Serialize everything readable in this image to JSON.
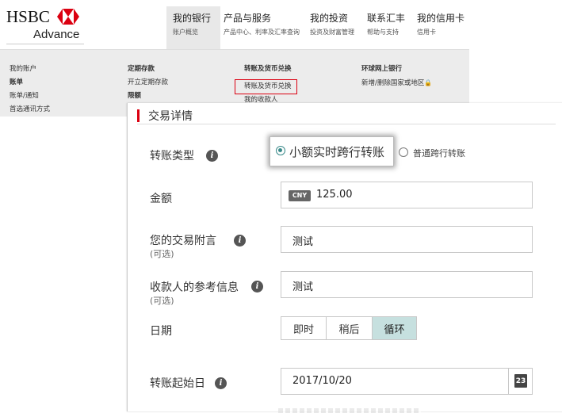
{
  "logo": {
    "brand": "HSBC",
    "sub": "Advance"
  },
  "nav": [
    {
      "title": "我的银行",
      "sub": "账户概览",
      "active": true
    },
    {
      "title": "产品与服务",
      "sub": "产品中心、利率及汇率查询"
    },
    {
      "title": "我的投资",
      "sub": "投资及财富管理"
    },
    {
      "title": "联系汇丰",
      "sub": "帮助与支持"
    },
    {
      "title": "我的信用卡",
      "sub": "信用卡"
    }
  ],
  "menu": {
    "col1": [
      "我的账户",
      "账单",
      "账单/通知",
      "首选通讯方式"
    ],
    "col2": [
      "定期存款",
      "开立定期存款",
      "限额"
    ],
    "col3": [
      "转账及货币兑换",
      "转账及货币兑换",
      "我的收款人"
    ],
    "col4": [
      "环球网上银行",
      "新增/删除国家或地区"
    ]
  },
  "form": {
    "title": "交易详情",
    "transfer_type_label": "转账类型",
    "option_selected": "小额实时跨行转账",
    "option_other": "普通跨行转账",
    "amount_label": "金额",
    "currency": "CNY",
    "amount": "125.00",
    "remark_label": "您的交易附言",
    "optional": "(可选)",
    "remark_value": "测试",
    "ref_label": "收款人的参考信息",
    "ref_value": "测试",
    "date_label": "日期",
    "date_options": [
      "即时",
      "稍后",
      "循环"
    ],
    "date_selected": "循环",
    "start_label": "转账起始日",
    "start_value": "2017/10/20",
    "calendar_day": "23",
    "info_glyph": "i"
  },
  "colors": {
    "accent": "#db0011",
    "selected_seg": "#c6e0df",
    "radio": "#3a8a8a"
  }
}
